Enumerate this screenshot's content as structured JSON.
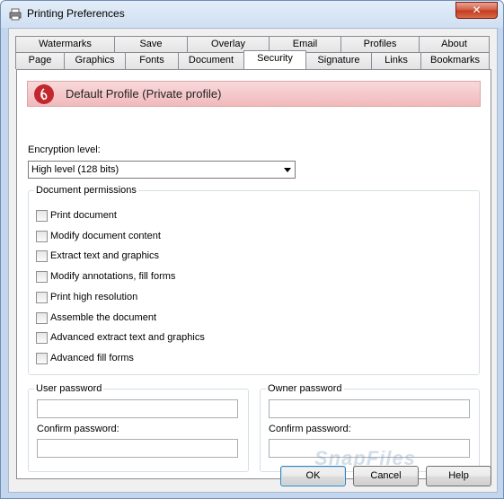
{
  "window": {
    "title": "Printing Preferences",
    "close_glyph": "✕"
  },
  "tabs": {
    "row1": [
      "Watermarks",
      "Save",
      "Overlay",
      "Email",
      "Profiles",
      "About"
    ],
    "row2": [
      "Page",
      "Graphics",
      "Fonts",
      "Document",
      "Security",
      "Signature",
      "Links",
      "Bookmarks"
    ],
    "active": "Security"
  },
  "profile": {
    "name": "Default Profile (Private profile)",
    "color": "#c1272d"
  },
  "encryption": {
    "label": "Encryption level:",
    "value": "High level (128 bits)"
  },
  "permissions": {
    "title": "Document permissions",
    "items": [
      "Print document",
      "Modify document content",
      "Extract text and graphics",
      "Modify annotations, fill forms",
      "Print high resolution",
      "Assemble the document",
      "Advanced extract text and graphics",
      "Advanced fill forms"
    ]
  },
  "user_password": {
    "title": "User password",
    "confirm_label": "Confirm password:"
  },
  "owner_password": {
    "title": "Owner password",
    "confirm_label": "Confirm password:"
  },
  "buttons": {
    "ok": "OK",
    "cancel": "Cancel",
    "help": "Help"
  },
  "watermark": "SnapFiles"
}
